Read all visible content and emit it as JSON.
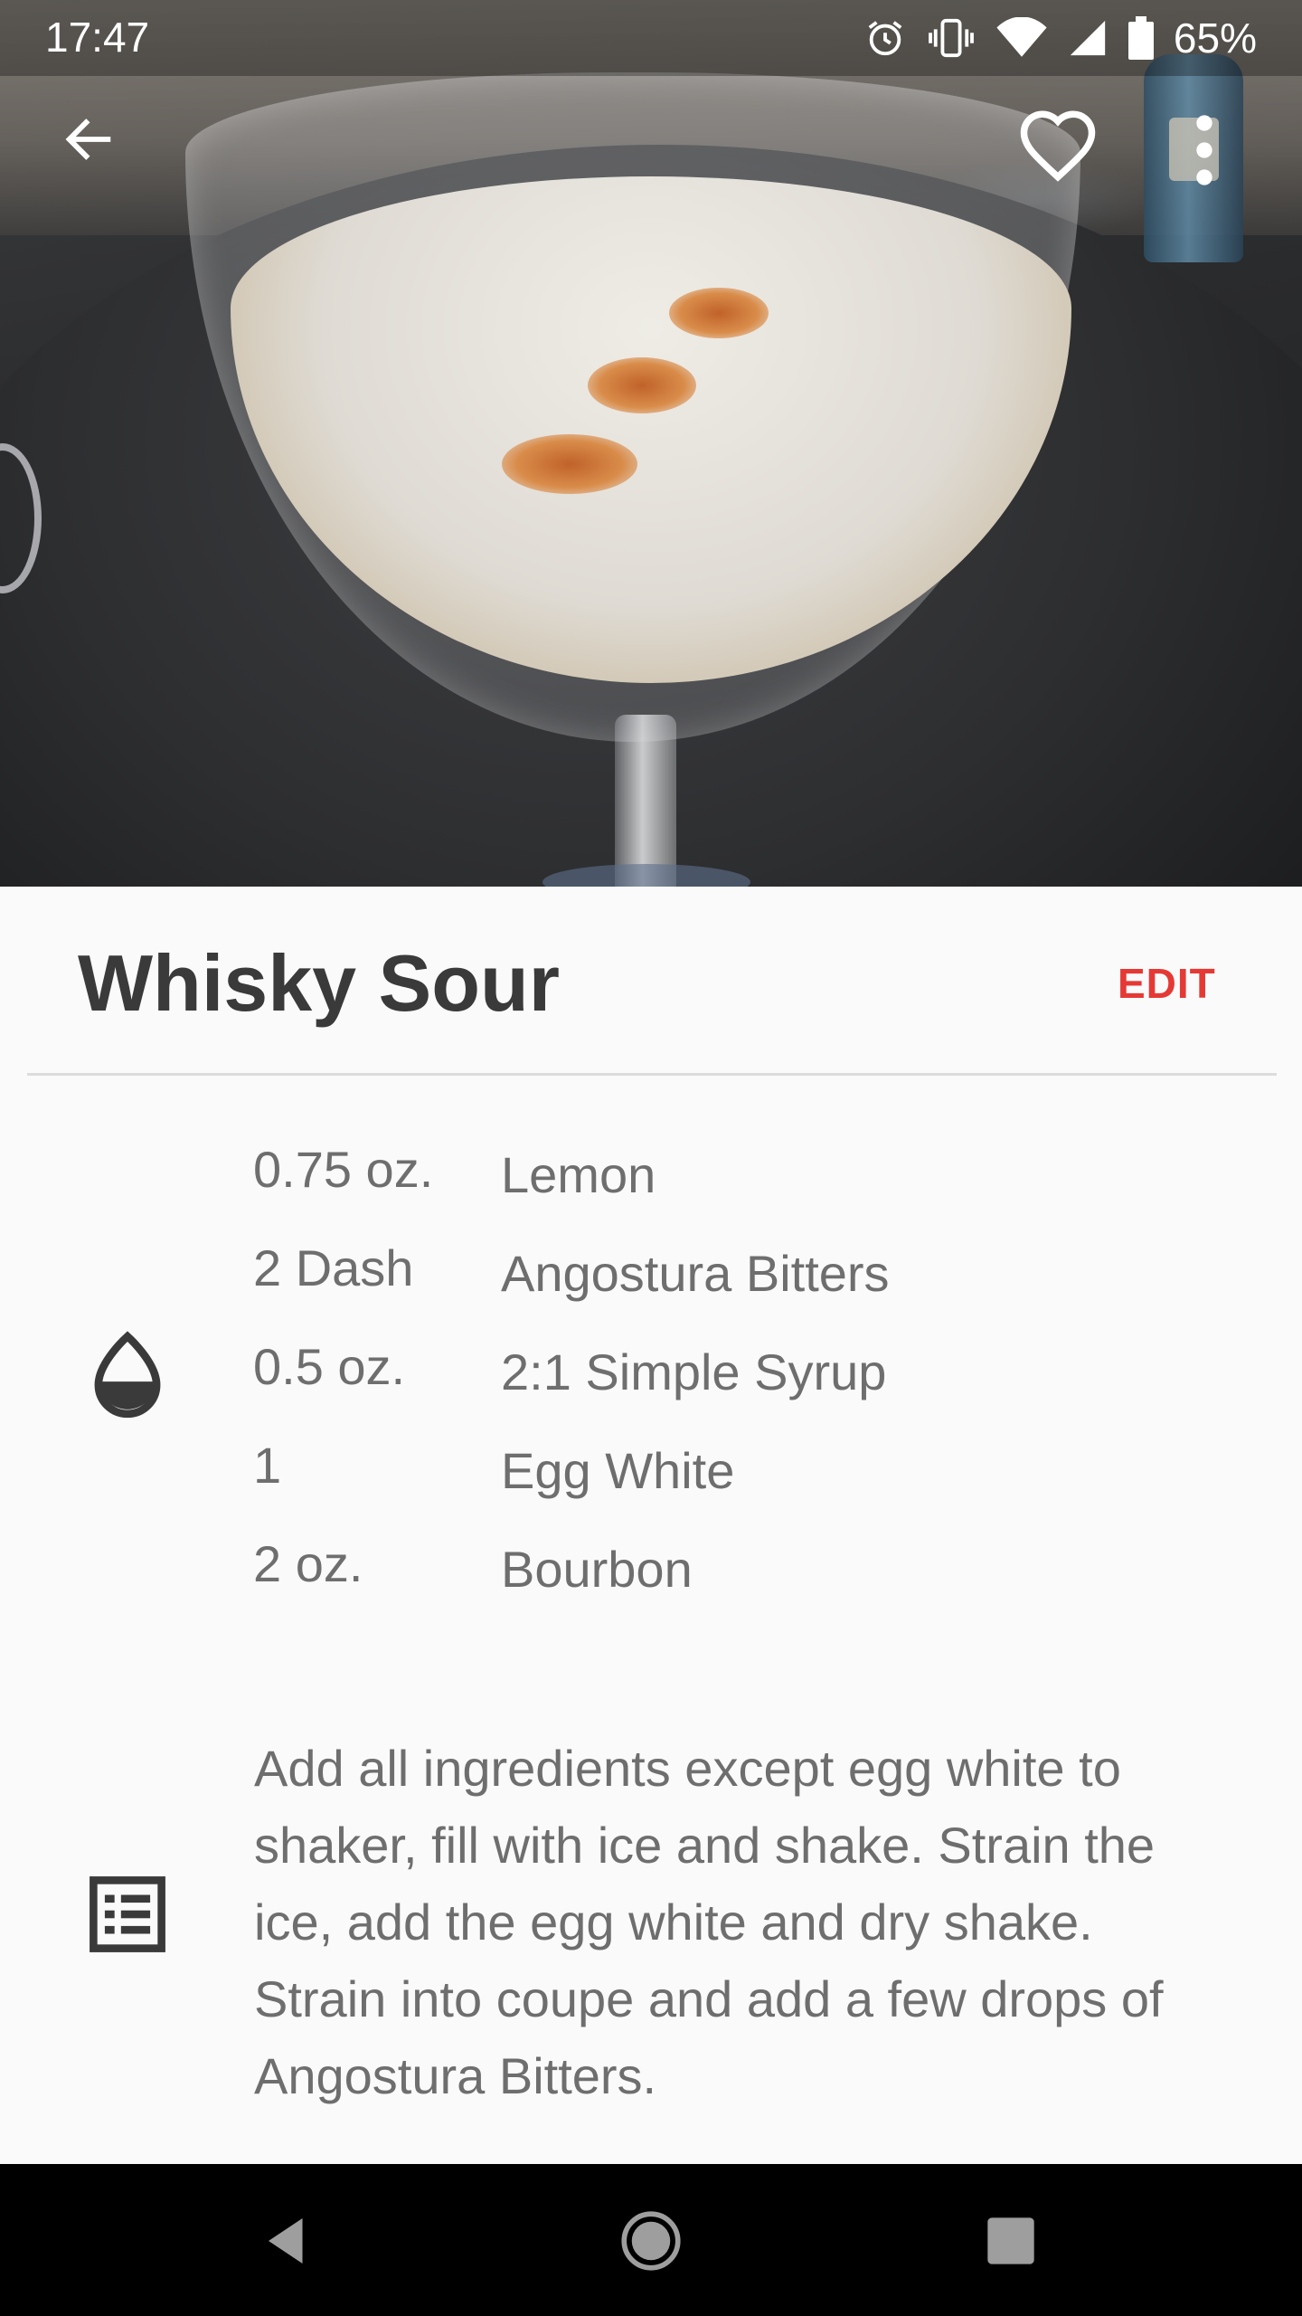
{
  "status_bar": {
    "time": "17:47",
    "battery_percent": "65%",
    "icons": [
      "alarm-icon",
      "vibrate-icon",
      "wifi-icon",
      "cell-signal-icon",
      "battery-icon"
    ]
  },
  "app_bar": {
    "back_icon": "arrow-back-icon",
    "favorite_icon": "heart-outline-icon",
    "menu_icon": "more-vert-icon"
  },
  "recipe": {
    "title": "Whisky Sour",
    "edit_label": "EDIT",
    "ingredients_icon": "drop-icon",
    "ingredients": [
      {
        "amount": "0.75 oz.",
        "name": "Lemon"
      },
      {
        "amount": "2 Dash",
        "name": "Angostura Bitters"
      },
      {
        "amount": "0.5 oz.",
        "name": "2:1 Simple Syrup"
      },
      {
        "amount": "1",
        "name": "Egg White"
      },
      {
        "amount": "2 oz.",
        "name": "Bourbon"
      }
    ],
    "instructions_icon": "list-icon",
    "instructions": "Add all ingredients except egg white to shaker, fill with ice and shake. Strain the ice, add the egg white and dry shake. Strain into coupe and add a few drops of Angostura Bitters."
  },
  "colors": {
    "accent": "#e53935",
    "title_text": "#3a3a3a",
    "body_text": "#6e6e6e",
    "background": "#fafafa"
  },
  "nav_bar": {
    "back_icon": "nav-back-icon",
    "home_icon": "nav-home-icon",
    "recents_icon": "nav-recents-icon"
  }
}
